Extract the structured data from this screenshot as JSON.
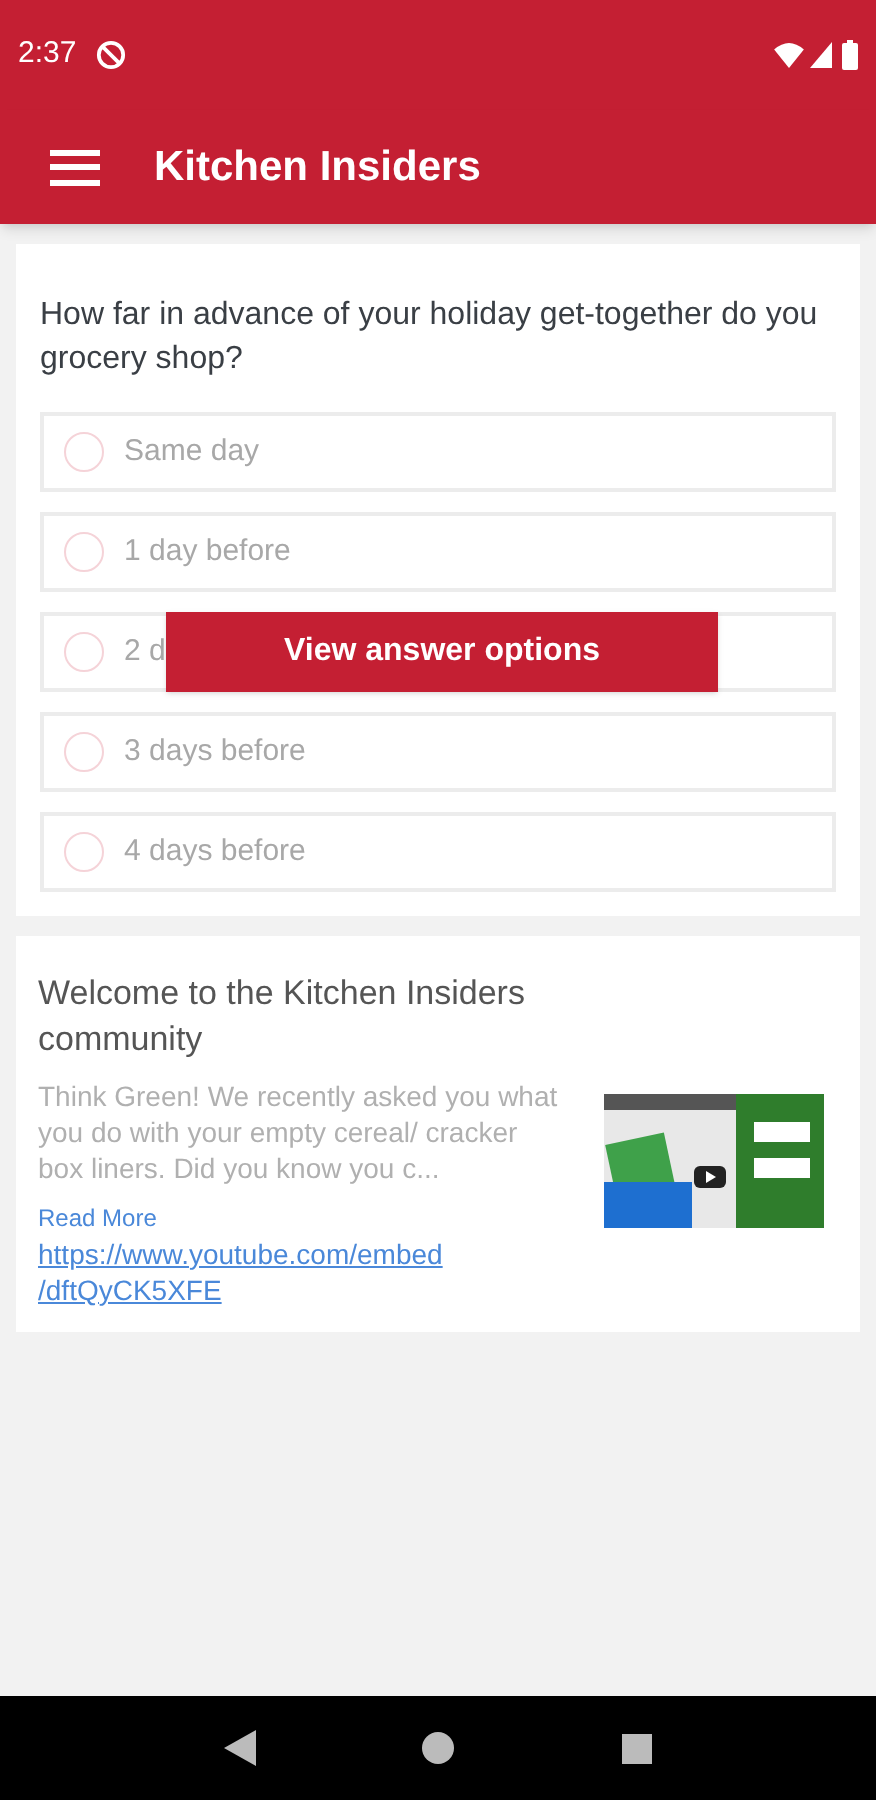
{
  "status_bar": {
    "time": "2:37"
  },
  "app_bar": {
    "title": "Kitchen Insiders"
  },
  "poll": {
    "question": "How far in advance of your holiday get-together do you grocery shop?",
    "options": [
      {
        "label": "Same day",
        "selected": false
      },
      {
        "label": "1 day before",
        "selected": false
      },
      {
        "label": "2 d",
        "selected": false
      },
      {
        "label": "3 days before",
        "selected": false
      },
      {
        "label": "4 days before",
        "selected": false
      }
    ],
    "overlay_button": "View answer options"
  },
  "post": {
    "title": "Welcome to the Kitchen Insiders community",
    "excerpt": "Think Green! We recently asked you what you do with your empty cereal/ cracker box liners. Did you know you c...",
    "read_more": "Read More",
    "link": "https://www.youtube.com/embed /dftQyCK5XFE"
  }
}
